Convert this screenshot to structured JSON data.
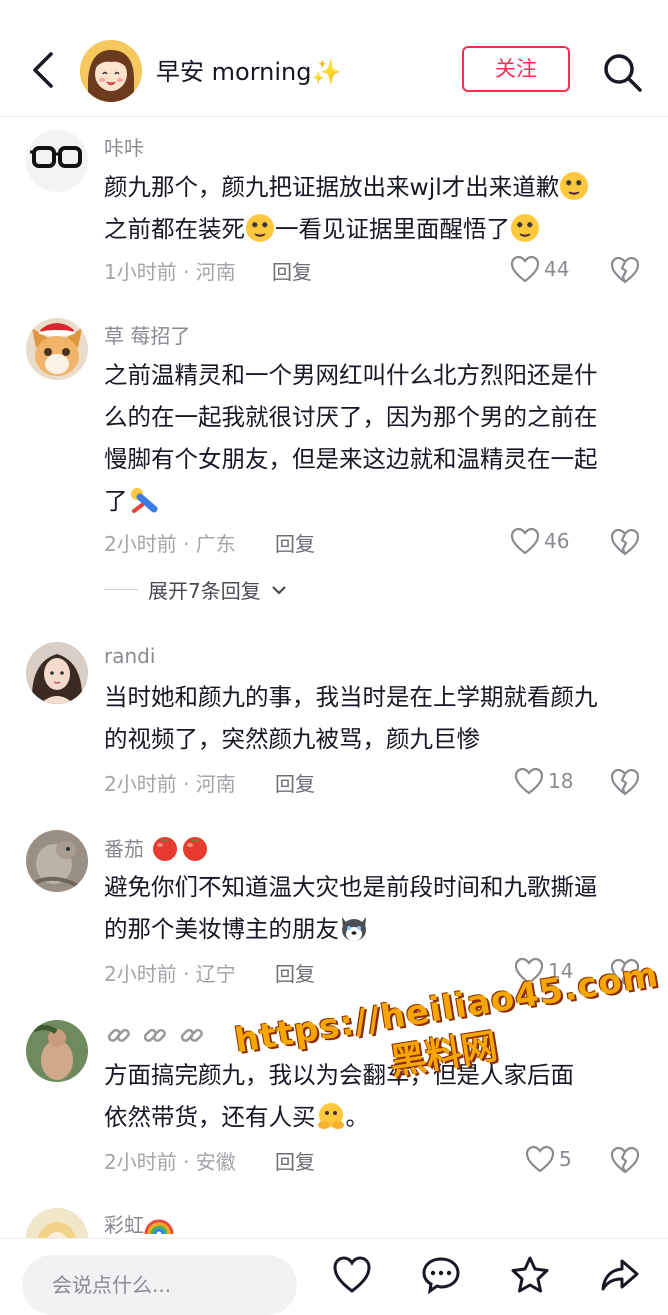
{
  "header": {
    "username": "早安 morning✨",
    "follow_label": "关注"
  },
  "comments": [
    {
      "user": "咔咔",
      "lines": [
        "颜九那个，颜九把证据放出来wjl才出来道歉",
        "之前都在装死",
        "一看见证据里面醒悟了"
      ],
      "meta": "1小时前 · 河南",
      "reply": "回复",
      "likes": "44"
    },
    {
      "user": "草 莓招了",
      "lines": [
        "之前温精灵和一个男网红叫什么北方烈阳还是什",
        "么的在一起我就很讨厌了，因为那个男的之前在",
        "慢脚有个女朋友，但是来这边就和温精灵在一起",
        "了"
      ],
      "meta": "2小时前 · 广东",
      "reply": "回复",
      "likes": "46"
    },
    {
      "user": "randi",
      "lines": [
        "当时她和颜九的事，我当时是在上学期就看颜九",
        "的视频了，突然颜九被骂，颜九巨惨"
      ],
      "meta": "2小时前 · 河南",
      "reply": "回复",
      "likes": "18"
    },
    {
      "user": "番茄",
      "lines": [
        "避免你们不知道温大灾也是前段时间和九歌撕逼",
        "的那个美妆博主的朋友"
      ],
      "meta": "2小时前 · 辽宁",
      "reply": "回复",
      "likes": "14"
    },
    {
      "user": "",
      "lines": [
        "方面搞完颜九，我以为会翻车，但是人家后面",
        "依然带货，还有人买",
        "。"
      ],
      "meta": "2小时前 · 安徽",
      "reply": "回复",
      "likes": "5"
    },
    {
      "user": "彩虹"
    }
  ],
  "expand_label": "展开7条回复",
  "watermark": {
    "url": "https://heiliao45.com",
    "brand": "黑料网"
  },
  "bottom": {
    "placeholder": "会说点什么..."
  }
}
